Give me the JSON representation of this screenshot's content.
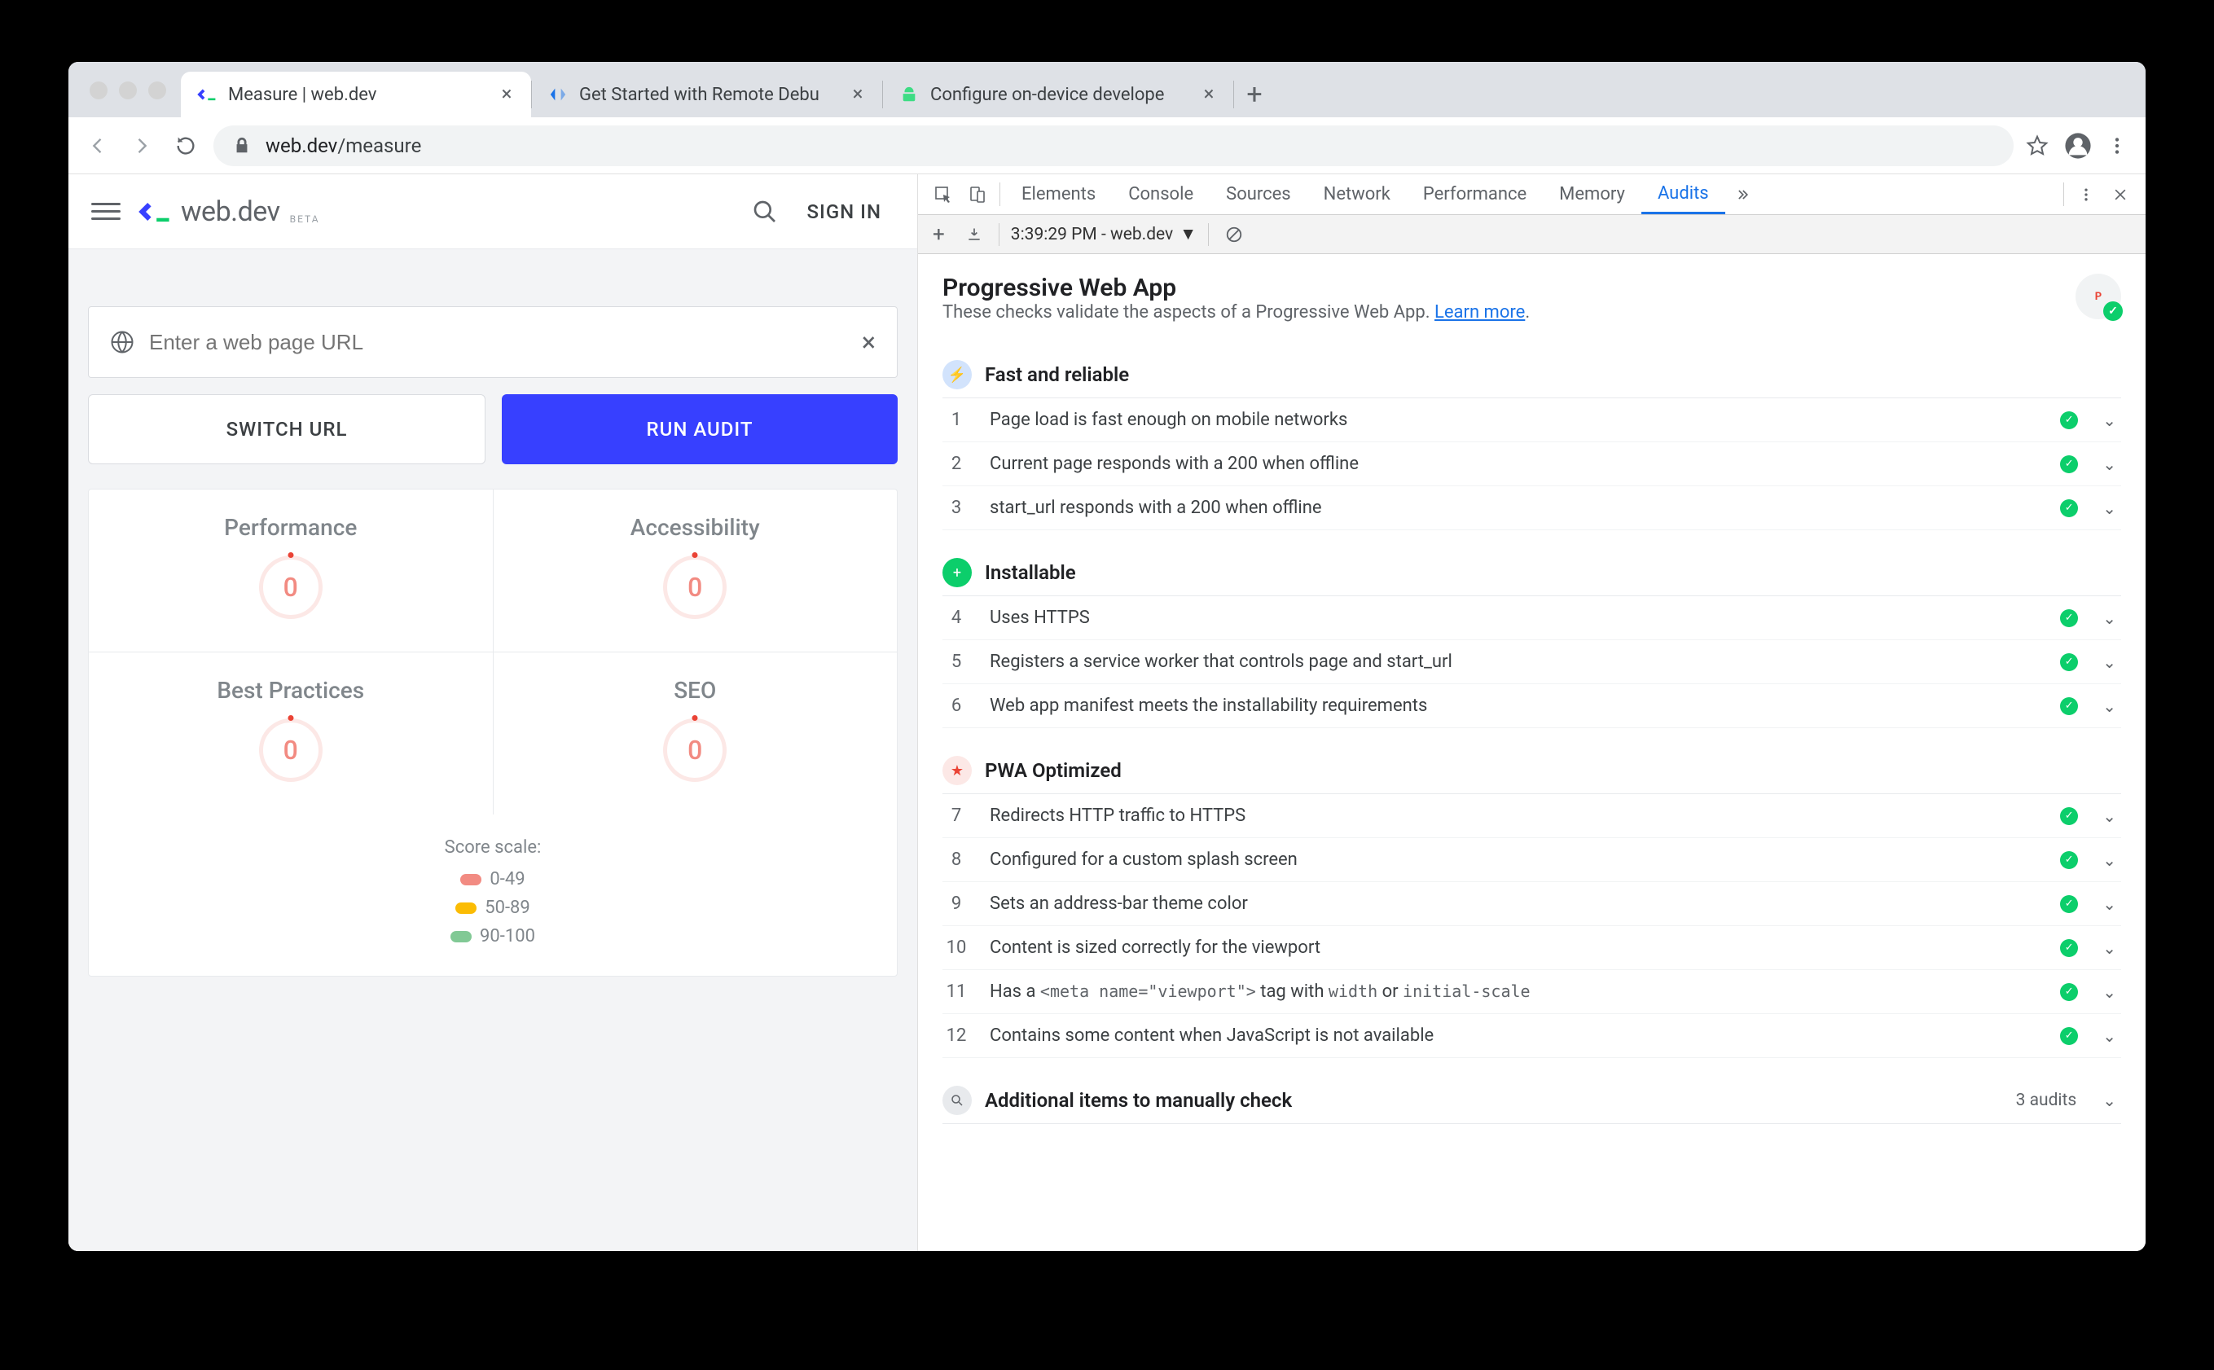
{
  "browser": {
    "tabs": [
      {
        "title": "Measure  |  web.dev",
        "active": true,
        "favicon": "webdev"
      },
      {
        "title": "Get Started with Remote Debu",
        "active": false,
        "favicon": "devtools"
      },
      {
        "title": "Configure on-device develope",
        "active": false,
        "favicon": "android"
      }
    ],
    "url_host": "web.dev",
    "url_path": "/measure"
  },
  "page": {
    "logo_text": "web.dev",
    "logo_beta": "BETA",
    "signin": "SIGN IN",
    "url_placeholder": "Enter a web page URL",
    "switch_btn": "SWITCH URL",
    "run_btn": "RUN AUDIT",
    "scores": [
      {
        "label": "Performance",
        "value": "0"
      },
      {
        "label": "Accessibility",
        "value": "0"
      },
      {
        "label": "Best Practices",
        "value": "0"
      },
      {
        "label": "SEO",
        "value": "0"
      }
    ],
    "scale_title": "Score scale:",
    "scale": [
      {
        "range": "0-49",
        "class": "red"
      },
      {
        "range": "50-89",
        "class": "orange"
      },
      {
        "range": "90-100",
        "class": "green"
      }
    ]
  },
  "devtools": {
    "tabs": [
      "Elements",
      "Console",
      "Sources",
      "Network",
      "Performance",
      "Memory",
      "Audits"
    ],
    "active_tab": "Audits",
    "toolbar_time": "3:39:29 PM - web.dev",
    "report": {
      "title": "Progressive Web App",
      "desc_pre": "These checks validate the aspects of a Progressive Web App. ",
      "learn_more": "Learn more",
      "sections": [
        {
          "icon": "blue",
          "glyph": "⚡",
          "title": "Fast and reliable",
          "audits": [
            {
              "n": "1",
              "text": "Page load is fast enough on mobile networks"
            },
            {
              "n": "2",
              "text": "Current page responds with a 200 when offline"
            },
            {
              "n": "3",
              "text": "start_url responds with a 200 when offline"
            }
          ]
        },
        {
          "icon": "green",
          "glyph": "+",
          "title": "Installable",
          "audits": [
            {
              "n": "4",
              "text": "Uses HTTPS"
            },
            {
              "n": "5",
              "text": "Registers a service worker that controls page and start_url"
            },
            {
              "n": "6",
              "text": "Web app manifest meets the installability requirements"
            }
          ]
        },
        {
          "icon": "star",
          "glyph": "★",
          "title": "PWA Optimized",
          "audits": [
            {
              "n": "7",
              "text": "Redirects HTTP traffic to HTTPS"
            },
            {
              "n": "8",
              "text": "Configured for a custom splash screen"
            },
            {
              "n": "9",
              "text": "Sets an address-bar theme color"
            },
            {
              "n": "10",
              "text": "Content is sized correctly for the viewport"
            },
            {
              "n": "11",
              "text_html": "Has a <code>&lt;meta name=\"viewport\"&gt;</code> tag with <code>width</code> or <code>initial-scale</code>"
            },
            {
              "n": "12",
              "text": "Contains some content when JavaScript is not available"
            }
          ]
        }
      ],
      "manual": {
        "title": "Additional items to manually check",
        "count": "3 audits"
      }
    }
  }
}
